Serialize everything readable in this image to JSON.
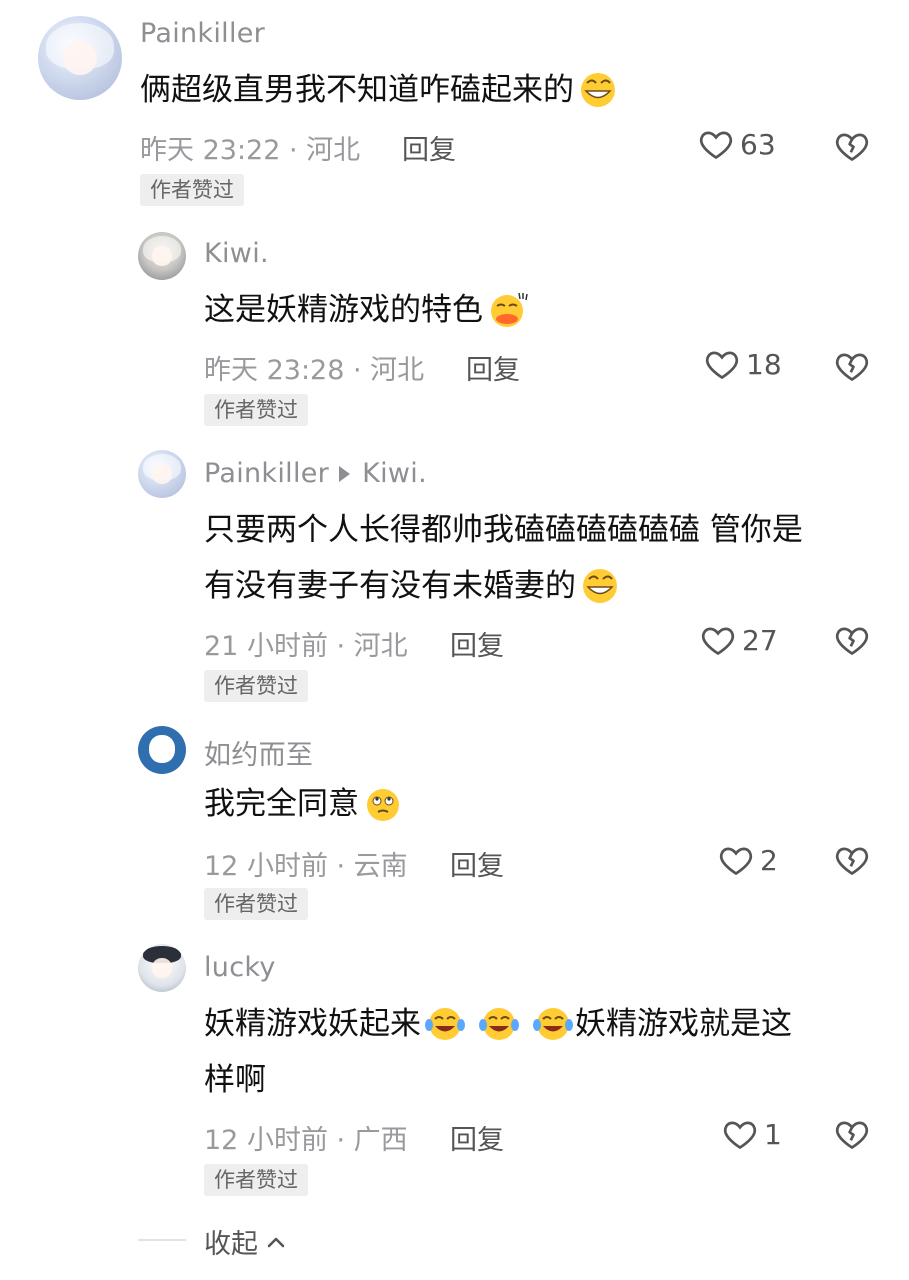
{
  "comments": [
    {
      "name": "Painkiller",
      "text": "俩超级直男我不知道咋磕起来的",
      "meta": "昨天 23:22 · 河北",
      "reply": "回复",
      "likes": "63",
      "badge": "作者赞过",
      "emoji": "grinning-face-emoji"
    },
    {
      "name": "Kiwi.",
      "text": "这是妖精游戏的特色",
      "meta": "昨天 23:28 · 河北",
      "reply": "回复",
      "likes": "18",
      "badge": "作者赞过",
      "emoji": "duck-lips-face-emoji"
    },
    {
      "name": "Painkiller",
      "reply_to": "Kiwi.",
      "text_line1": "只要两个人长得都帅我磕磕磕磕磕磕 管你是",
      "text_line2": "有没有妻子有没有未婚妻的",
      "meta": "21 小时前 · 河北",
      "reply": "回复",
      "likes": "27",
      "badge": "作者赞过",
      "emoji": "grinning-face-emoji"
    },
    {
      "name": "如约而至",
      "text": "我完全同意",
      "meta": "12 小时前 · 云南",
      "reply": "回复",
      "likes": "2",
      "badge": "作者赞过",
      "emoji": "eye-roll-face-emoji"
    },
    {
      "name": "lucky",
      "text_line1a": "妖精游戏妖起来",
      "text_line1b": "妖精游戏就是这",
      "text_line2": "样啊",
      "meta": "12 小时前 · 广西",
      "reply": "回复",
      "likes": "1",
      "badge": "作者赞过",
      "emoji": "tears-of-joy-emoji"
    }
  ],
  "collapse_label": "收起",
  "colors": {
    "name": "#8e8e93",
    "text": "#111111",
    "meta": "#9a9a9e",
    "badge_bg": "#eeeeee",
    "emoji_yellow": "#ffcc33"
  }
}
